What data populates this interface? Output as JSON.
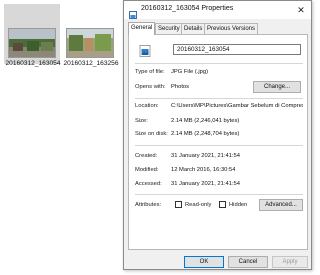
{
  "explorer": {
    "files": [
      {
        "label": "20160312_163054",
        "selected": true
      },
      {
        "label": "20160312_163256",
        "selected": false
      }
    ]
  },
  "dialog": {
    "title": "20160312_163054 Properties",
    "close_glyph": "✕",
    "tabs": [
      "General",
      "Security",
      "Details",
      "Previous Versions"
    ],
    "active_tab": "General",
    "file_name": "20160312_163054",
    "type_label": "Type of file:",
    "type_value": "JPG File (.jpg)",
    "opens_label": "Opens with:",
    "opens_value": "Photos",
    "change_button": "Change...",
    "location_label": "Location:",
    "location_value": "C:\\Users\\MP\\Pictures\\Gambar Sebelum di Compres",
    "size_label": "Size:",
    "size_value": "2.14 MB (2,246,041 bytes)",
    "size_on_disk_label": "Size on disk:",
    "size_on_disk_value": "2.14 MB (2,248,704 bytes)",
    "created_label": "Created:",
    "created_value": "31 January 2021, 21:41:54",
    "modified_label": "Modified:",
    "modified_value": "12 March 2016, 16:30:54",
    "accessed_label": "Accessed:",
    "accessed_value": "31 January 2021, 21:41:54",
    "attributes_label": "Attributes:",
    "readonly_label": "Read-only",
    "hidden_label": "Hidden",
    "advanced_button": "Advanced...",
    "ok_button": "OK",
    "cancel_button": "Cancel",
    "apply_button": "Apply"
  },
  "colors": {
    "selection": "#d8d8d8",
    "focus_border": "#0078d7",
    "dialog_bg": "#f0f0f0"
  }
}
